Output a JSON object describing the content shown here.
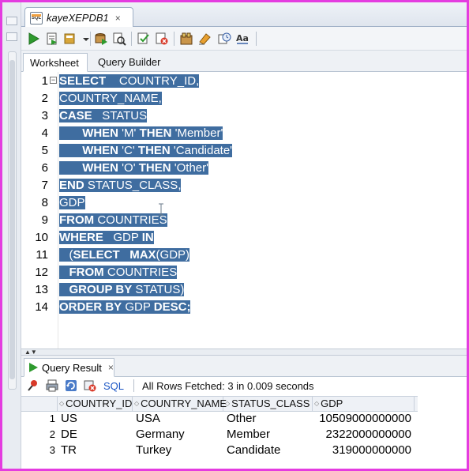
{
  "editor_tab": {
    "title": "kayeXEPDB1",
    "icon": "sql-file-icon"
  },
  "toolbar": {
    "buttons": [
      "run-statement-icon",
      "run-script-icon",
      "commit-icon",
      "rollback-icon",
      "explain-plan-icon",
      "autotrace-icon",
      "sql-tuning-icon",
      "clear-icon",
      "history-icon",
      "format-icon"
    ]
  },
  "worksheet_tabs": [
    {
      "label": "Worksheet",
      "active": true
    },
    {
      "label": "Query Builder",
      "active": false
    }
  ],
  "editor": {
    "selection_color": "#3f6da0",
    "line_numbers": [
      "1",
      "2",
      "3",
      "4",
      "5",
      "6",
      "7",
      "8",
      "9",
      "10",
      "11",
      "12",
      "13",
      "14"
    ],
    "lines": [
      [
        {
          "t": "SELECT",
          "kw": true
        },
        {
          "t": "    COUNTRY_ID,",
          "kw": false
        }
      ],
      [
        {
          "t": "COUNTRY_NAME,",
          "kw": false
        }
      ],
      [
        {
          "t": "CASE",
          "kw": true
        },
        {
          "t": "   STATUS",
          "kw": false
        }
      ],
      [
        {
          "t": "       ",
          "kw": false
        },
        {
          "t": "WHEN",
          "kw": true
        },
        {
          "t": " 'M' ",
          "kw": false
        },
        {
          "t": "THEN",
          "kw": true
        },
        {
          "t": " 'Member'",
          "kw": false
        }
      ],
      [
        {
          "t": "       ",
          "kw": false
        },
        {
          "t": "WHEN",
          "kw": true
        },
        {
          "t": " 'C' ",
          "kw": false
        },
        {
          "t": "THEN",
          "kw": true
        },
        {
          "t": " 'Candidate'",
          "kw": false
        }
      ],
      [
        {
          "t": "       ",
          "kw": false
        },
        {
          "t": "WHEN",
          "kw": true
        },
        {
          "t": " 'O' ",
          "kw": false
        },
        {
          "t": "THEN",
          "kw": true
        },
        {
          "t": " 'Other'",
          "kw": false
        }
      ],
      [
        {
          "t": "END",
          "kw": true
        },
        {
          "t": " STATUS_CLASS,",
          "kw": false
        }
      ],
      [
        {
          "t": "GDP",
          "kw": false
        }
      ],
      [
        {
          "t": "FROM",
          "kw": true
        },
        {
          "t": " COUNTRIES",
          "kw": false
        }
      ],
      [
        {
          "t": "WHERE",
          "kw": true
        },
        {
          "t": "   GDP ",
          "kw": false
        },
        {
          "t": "IN",
          "kw": true
        }
      ],
      [
        {
          "t": "   (",
          "kw": false
        },
        {
          "t": "SELECT",
          "kw": true
        },
        {
          "t": "   ",
          "kw": false
        },
        {
          "t": "MAX",
          "kw": true
        },
        {
          "t": "(GDP)",
          "kw": false
        }
      ],
      [
        {
          "t": "   ",
          "kw": false
        },
        {
          "t": "FROM",
          "kw": true
        },
        {
          "t": " COUNTRIES",
          "kw": false
        }
      ],
      [
        {
          "t": "   ",
          "kw": false
        },
        {
          "t": "GROUP BY",
          "kw": true
        },
        {
          "t": " STATUS)",
          "kw": false
        }
      ],
      [
        {
          "t": "ORDER BY",
          "kw": true
        },
        {
          "t": " GDP ",
          "kw": false
        },
        {
          "t": "DESC;",
          "kw": true
        }
      ]
    ]
  },
  "results": {
    "tab_label": "Query Result",
    "sql_link": "SQL",
    "status": "All Rows Fetched: 3 in 0.009 seconds",
    "columns": [
      "COUNTRY_ID",
      "COUNTRY_NAME",
      "STATUS_CLASS",
      "GDP"
    ],
    "rows": [
      {
        "num": "1",
        "cells": [
          "US",
          "USA",
          "Other",
          "10509000000000"
        ]
      },
      {
        "num": "2",
        "cells": [
          "DE",
          "Germany",
          "Member",
          "2322000000000"
        ]
      },
      {
        "num": "3",
        "cells": [
          "TR",
          "Turkey",
          "Candidate",
          "319000000000"
        ]
      }
    ]
  }
}
